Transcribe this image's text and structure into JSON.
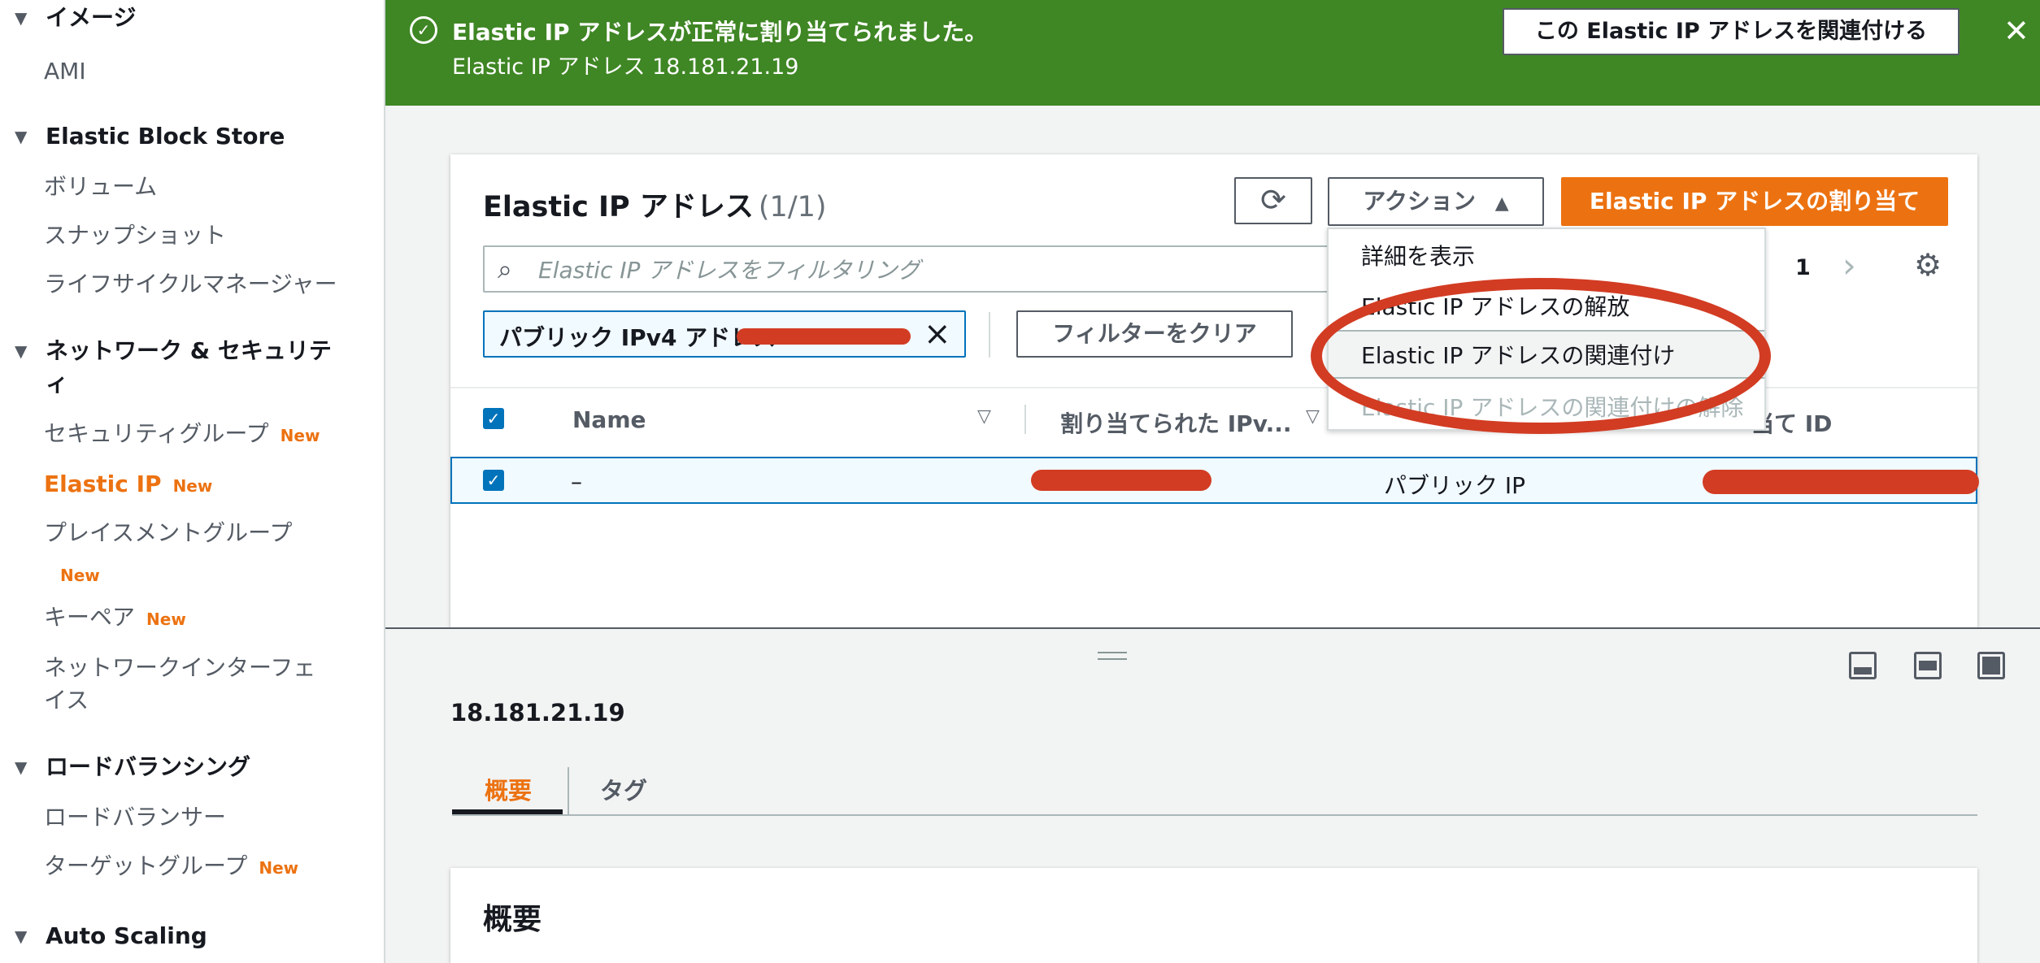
{
  "sidebar": {
    "sections": [
      {
        "label": "イメージ",
        "items": [
          {
            "label": "AMI"
          }
        ]
      },
      {
        "label": "Elastic Block Store",
        "items": [
          {
            "label": "ボリューム"
          },
          {
            "label": "スナップショット"
          },
          {
            "label": "ライフサイクルマネージャー"
          }
        ]
      },
      {
        "label": "ネットワーク & セキュリティ",
        "items": [
          {
            "label": "セキュリティグループ",
            "badge": "New"
          },
          {
            "label": "Elastic IP",
            "badge": "New"
          },
          {
            "label": "プレイスメントグループ",
            "badge": "New"
          },
          {
            "label": "キーペア",
            "badge": "New"
          },
          {
            "label": "ネットワークインターフェイス"
          }
        ]
      },
      {
        "label": "ロードバランシング",
        "items": [
          {
            "label": "ロードバランサー"
          },
          {
            "label": "ターゲットグループ",
            "badge": "New"
          }
        ]
      },
      {
        "label": "Auto Scaling",
        "items": []
      }
    ],
    "active_item": "Elastic IP"
  },
  "banner": {
    "title": "Elastic IP アドレスが正常に割り当てられました。",
    "subtitle": "Elastic IP アドレス 18.181.21.19",
    "associate_button": "この Elastic IP アドレスを関連付ける",
    "close_glyph": "✕",
    "color": "#3f8624"
  },
  "panel": {
    "title": "Elastic IP アドレス",
    "count": "(1/1)",
    "actions_label": "アクション",
    "allocate_label": "Elastic IP アドレスの割り当て",
    "search_placeholder": "Elastic IP アドレスをフィルタリング",
    "page_number": "1",
    "filter_token": "パブリック IPv4 アドレス",
    "clear_filter": "フィルターをクリア",
    "columns": [
      "Name",
      "割り当てられた IPv...",
      "当て ID"
    ],
    "row": {
      "name": "–",
      "type": "パブリック IP"
    }
  },
  "dropdown": {
    "items": [
      {
        "label": "詳細を表示"
      },
      {
        "label": "Elastic IP アドレスの解放"
      },
      {
        "label": "Elastic IP アドレスの関連付け"
      },
      {
        "label": "Elastic IP アドレスの関連付けの解除"
      }
    ]
  },
  "details": {
    "ip": "18.181.21.19",
    "tabs": [
      "概要",
      "タグ"
    ],
    "summary_title": "概要"
  },
  "colors": {
    "accent": "#ec7211",
    "selection": "#0073bb",
    "annotation": "#d23c23"
  }
}
